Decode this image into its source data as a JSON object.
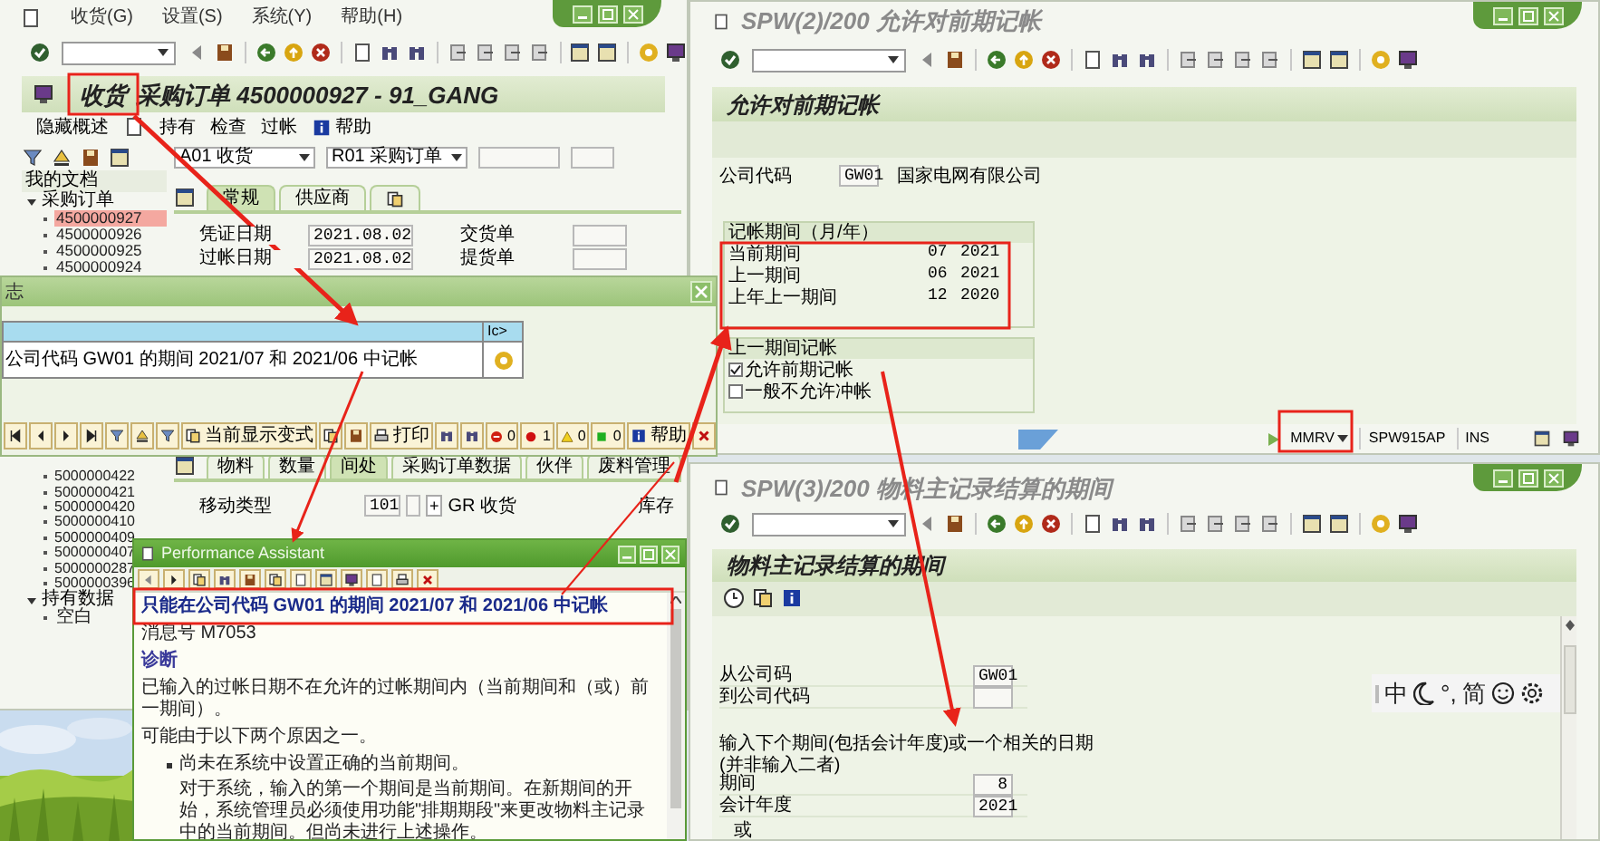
{
  "left_window": {
    "menu": [
      "收货(G)",
      "设置(S)",
      "系统(Y)",
      "帮助(H)"
    ],
    "title_parts": [
      "收货",
      "采购订单 4500000927 - 91_GANG"
    ],
    "app_toolbar": [
      "隐藏概述",
      "持有",
      "检查",
      "过帐"
    ],
    "help_button": "帮助",
    "tree": {
      "header": "我的文档",
      "folders": [
        {
          "label": "采购订单",
          "expanded": true,
          "children": [
            {
              "label": "4500000927",
              "selected": true
            },
            {
              "label": "4500000926",
              "selected": false
            },
            {
              "label": "4500000925",
              "selected": false
            },
            {
              "label": "4500000924",
              "selected": false
            }
          ]
        },
        {
          "label": "持有数据",
          "expanded": true,
          "children": [
            {
              "label": "空白",
              "selected": false
            }
          ]
        }
      ],
      "lower_items": [
        "5000000422",
        "5000000421",
        "5000000420",
        "5000000410",
        "5000000409",
        "5000000407",
        "5000000287",
        "5000000396"
      ]
    },
    "dropdowns": [
      "A01 收货",
      "R01 采购订单"
    ],
    "tabs": [
      {
        "kind": "text",
        "label": "常规",
        "selected": true
      },
      {
        "kind": "text",
        "label": "供应商",
        "selected": false
      },
      {
        "kind": "icon",
        "selected": false
      }
    ],
    "fields": [
      {
        "label": "凭证日期",
        "value": "2021.08.02",
        "label_2": "交货单"
      },
      {
        "label": "过帐日期",
        "value": "2021.08.02",
        "label_2": "提货单"
      }
    ],
    "item_tabs": [
      {
        "label": "物料",
        "selected": false
      },
      {
        "label": "数量",
        "selected": false
      },
      {
        "label": "间处",
        "selected": true
      },
      {
        "label": "采购订单数据",
        "selected": false
      },
      {
        "label": "伙伴",
        "selected": false
      },
      {
        "label": "废料管理",
        "selected": false
      }
    ],
    "movement": {
      "label": "移动类型",
      "code": "101",
      "sign": "+",
      "text": "GR 收货",
      "right_label": "库存"
    }
  },
  "log_popup": {
    "title": "志",
    "header_cell": "Ic>",
    "rows": [
      {
        "text": "公司代码 GW01 的期间 2021/07 和 2021/06 中记帐"
      }
    ],
    "toolbar": {
      "variant_button": "当前显示变式",
      "print_button": "打印",
      "counts": [
        {
          "kind": "stop",
          "count": "0"
        },
        {
          "kind": "error",
          "count": "1"
        },
        {
          "kind": "warning",
          "count": "0"
        },
        {
          "kind": "success",
          "count": "0"
        }
      ],
      "help_button": "帮助"
    }
  },
  "spw2": {
    "title": "SPW(2)/200 允许对前期记帐",
    "header": "允许对前期记帐",
    "company": {
      "label": "公司代码",
      "code": "GW01",
      "name": "国家电网有限公司"
    },
    "periods": {
      "title": "记帐期间（月/年）",
      "rows": [
        {
          "label": "当前期间",
          "month": "07",
          "year": "2021"
        },
        {
          "label": "上一期间",
          "month": "06",
          "year": "2021"
        },
        {
          "label": "上年上一期间",
          "month": "12",
          "year": "2020"
        }
      ]
    },
    "prior": {
      "title": "上一期间记帐",
      "options": [
        {
          "label": "允许前期记帐",
          "checked": true
        },
        {
          "label": "一般不允许冲帐",
          "checked": false
        }
      ]
    },
    "status": {
      "transaction": "MMRV",
      "server": "SPW915AP",
      "mode": "INS"
    }
  },
  "spw3": {
    "title": "SPW(3)/200 物料主记录结算的期间",
    "header": "物料主记录结算的期间",
    "company_fields": [
      {
        "label": "从公司码",
        "value": "GW01"
      },
      {
        "label": "到公司代码"
      }
    ],
    "instruction": "输入下个期间(包括会计年度)或一个相关的日期",
    "note": "(并非输入二者)",
    "period_fields": [
      {
        "label": "期间",
        "value": "8"
      },
      {
        "label": "会计年度",
        "value": "2021"
      }
    ],
    "or_label": "或"
  },
  "performance_assistant": {
    "title": "Performance Assistant",
    "heading": "只能在公司代码 GW01 的期间 2021/07 和 2021/06 中记帐",
    "message_no": "消息号 M7053",
    "section": "诊断",
    "paragraphs": [
      "已输入的过帐日期不在允许的过帐期间内（当前期间和（或）前一期间）。",
      "可能由于以下两个原因之一。"
    ],
    "bullets": [
      {
        "text": "尚未在系统中设置正确的当前期间。",
        "detail": "对于系统，输入的第一个期间是当前期间。在新期间的开始，系统管理员必须使用功能\"排期期段\"来更改物料主记录中的当前期间。但尚未进行上述操作。"
      }
    ]
  },
  "ime_bar": {
    "items": [
      {
        "kind": "text",
        "label": "中"
      },
      {
        "kind": "moon"
      },
      {
        "kind": "text",
        "label": "°,"
      },
      {
        "kind": "text",
        "label": "简"
      },
      {
        "kind": "smile"
      },
      {
        "kind": "gear"
      }
    ]
  }
}
